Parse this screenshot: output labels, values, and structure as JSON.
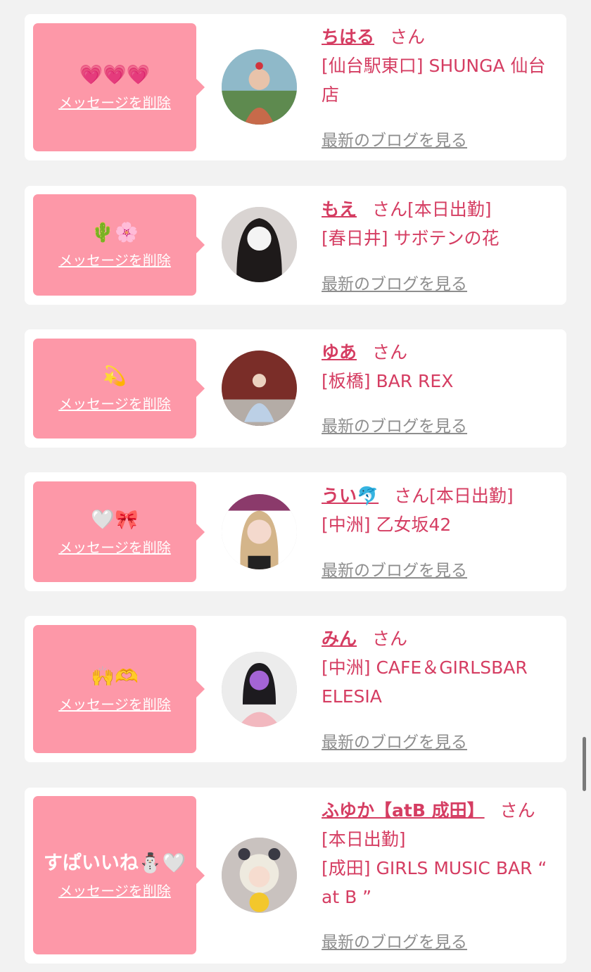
{
  "delete_label": "メッセージを削除",
  "blog_label": "最新のブログを見る",
  "san_label": "さん",
  "colors": {
    "accent": "#d53d62",
    "bubble": "#fd98a8",
    "link_gray": "#8e8e8e"
  },
  "cards": [
    {
      "message": "💗💗💗",
      "name": "ちはる",
      "status": "",
      "shop": "[仙台駅東口] SHUNGA 仙台店"
    },
    {
      "message": "🌵🌸",
      "name": "もえ",
      "status": "[本日出勤]",
      "shop": "[春日井] サボテンの花"
    },
    {
      "message": "💫",
      "name": "ゆあ",
      "status": "",
      "shop": "[板橋] BAR REX"
    },
    {
      "message": "🤍🎀",
      "name": "うい🐬",
      "status": "[本日出勤]",
      "shop": "[中洲] 乙女坂42"
    },
    {
      "message": "🙌🫶",
      "name": "みん",
      "status": "",
      "shop": "[中洲] CAFE＆GIRLSBAR ELESIA"
    },
    {
      "message": "すぱいいね⛄🤍",
      "name": "ふゆか【atB 成田】",
      "status": "[本日出勤]",
      "shop": "[成田] GIRLS MUSIC BAR “ at B ”"
    }
  ]
}
